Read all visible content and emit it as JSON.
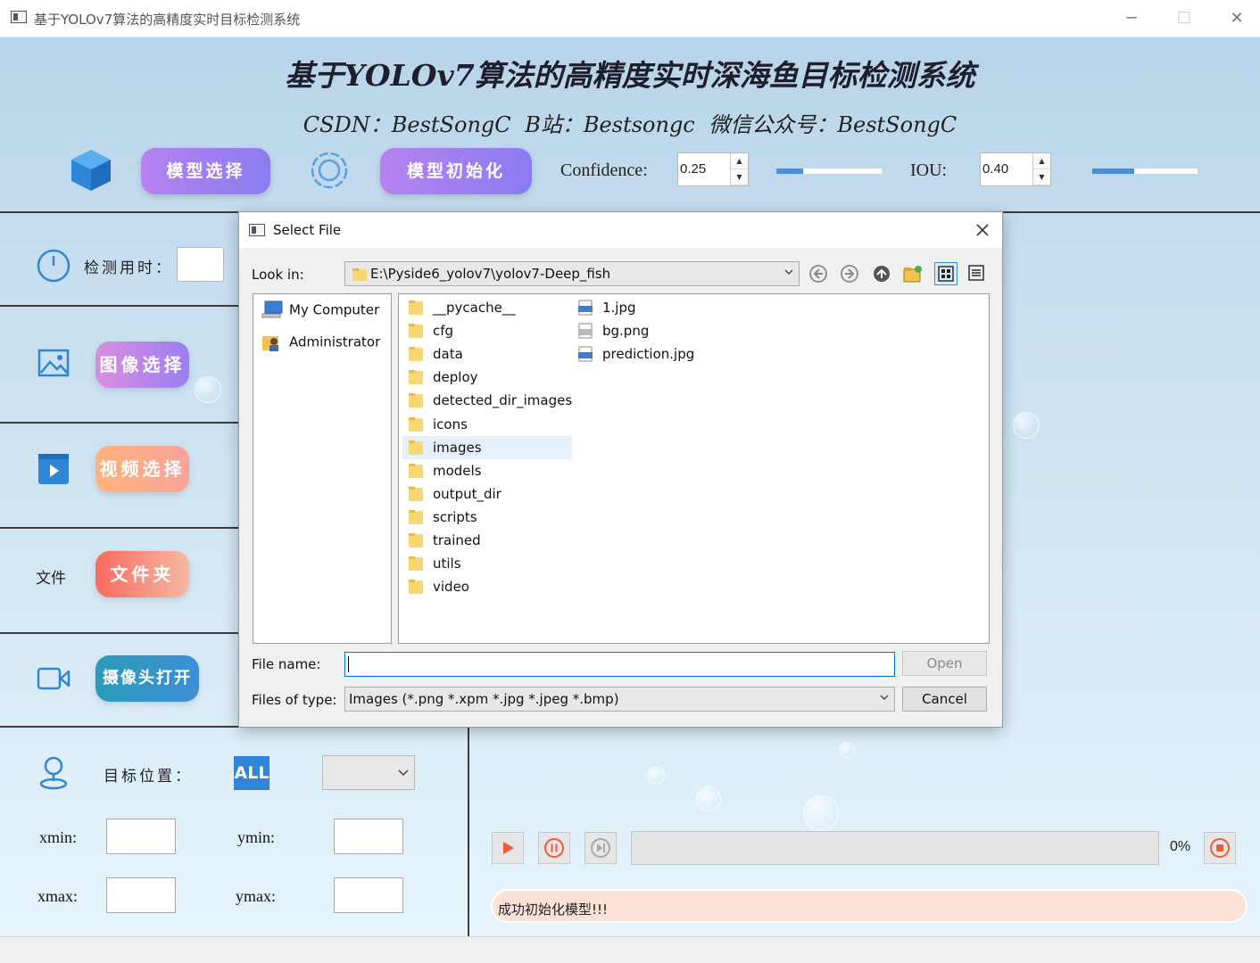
{
  "window": {
    "title": "基于YOLOv7算法的高精度实时目标检测系统",
    "minimize": "─",
    "maximize": "☐",
    "close": "✕"
  },
  "header": {
    "title": "基于YOLOv7算法的高精度实时深海鱼目标检测系统",
    "subtitle": "CSDN：BestSongC   B站：Bestsongc   微信公众号：BestSongC"
  },
  "toolbar": {
    "model_select": "模型选择",
    "model_init": "模型初始化",
    "confidence_label": "Confidence:",
    "confidence_value": "0.25",
    "confidence_level": 0.25,
    "iou_label": "IOU:",
    "iou_value": "0.40",
    "iou_level": 0.4
  },
  "sidebar": {
    "detect_time_label": "检测用时：",
    "detect_time_value": "",
    "image_button": "图像选择",
    "video_button": "视频选择",
    "folder_label": "文件",
    "folder_button": "文件夹",
    "camera_button": "摄像头打开",
    "target_label": "目标位置：",
    "target_all": "ALL",
    "xmin_label": "xmin:",
    "ymin_label": "ymin:",
    "xmax_label": "xmax:",
    "ymax_label": "ymax:"
  },
  "player": {
    "progress_value": 0,
    "progress_text": "0%"
  },
  "status": {
    "message": "成功初始化模型!!!"
  },
  "dialog": {
    "title": "Select File",
    "look_in_label": "Look in:",
    "path": "E:\\Pyside6_yolov7\\yolov7-Deep_fish",
    "places": [
      "My Computer",
      "Administrator"
    ],
    "folders": [
      "__pycache__",
      "cfg",
      "data",
      "deploy",
      "detected_dir_images",
      "icons",
      "images",
      "models",
      "output_dir",
      "scripts",
      "trained",
      "utils",
      "video"
    ],
    "files": [
      "1.jpg",
      "bg.png",
      "prediction.jpg"
    ],
    "selected_folder": "images",
    "file_name_label": "File name:",
    "file_name_value": "",
    "files_of_type_label": "Files of type:",
    "files_of_type_value": "Images (*.png *.xpm *.jpg *.jpeg *.bmp)",
    "open_button": "Open",
    "cancel_button": "Cancel"
  },
  "colors": {
    "accent_blue": "#4a90d8",
    "purple_button": "#a27ff0",
    "status_bg": "#fde2d8",
    "selection": "#e5f0fb"
  }
}
